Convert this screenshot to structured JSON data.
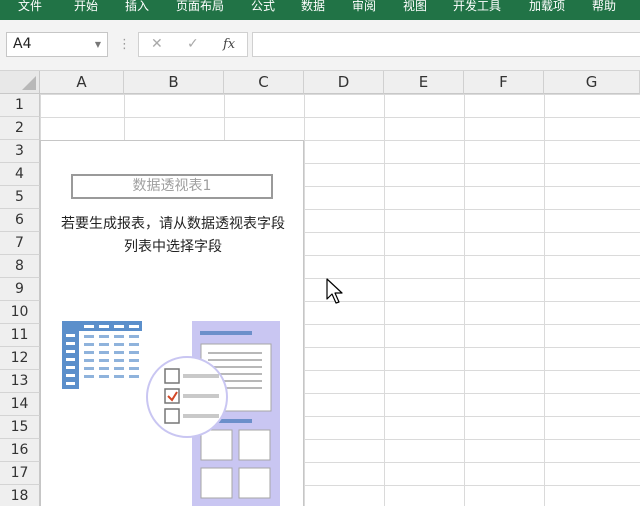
{
  "ribbon": {
    "tabs": [
      "文件",
      "开始",
      "插入",
      "页面布局",
      "公式",
      "数据",
      "审阅",
      "视图",
      "开发工具",
      "加载项",
      "帮助"
    ]
  },
  "formula_bar": {
    "name_box": "A4",
    "cancel_glyph": "✕",
    "enter_glyph": "✓",
    "fx_label": "fx",
    "formula": ""
  },
  "grid": {
    "columns": [
      "A",
      "B",
      "C",
      "D",
      "E",
      "F",
      "G"
    ],
    "rows": [
      "1",
      "2",
      "3",
      "4",
      "5",
      "6",
      "7",
      "8",
      "9",
      "10",
      "11",
      "12",
      "13",
      "14",
      "15",
      "16",
      "17",
      "18"
    ]
  },
  "pivot": {
    "name": "数据透视表1",
    "message_line1": "若要生成报表，请从数据透视表字段",
    "message_line2": "列表中选择字段"
  },
  "colors": {
    "ribbon": "#217346",
    "table_icon": "#5b8fcb",
    "field_panel": "#c9c6f2",
    "check": "#d24726"
  },
  "icons": [
    "pivot-table-icon",
    "field-list-icon",
    "checkbox-list-icon",
    "mouse-cursor-icon"
  ]
}
